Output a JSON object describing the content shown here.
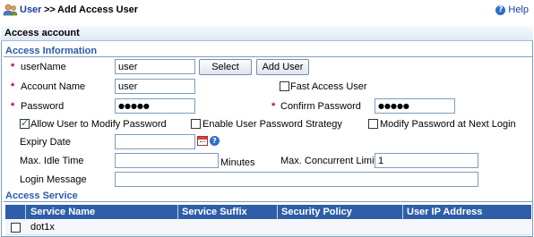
{
  "header": {
    "breadcrumb_link": "User",
    "breadcrumb_sep": ">>",
    "page_title": "Add Access User",
    "help_label": "Help",
    "help_icon": "?"
  },
  "panel": {
    "title": "Access account"
  },
  "access_info": {
    "section_title": "Access Information",
    "required_mark": "*",
    "username": {
      "label": "userName",
      "value": "user",
      "select_button": "Select",
      "add_button": "Add User"
    },
    "account_name": {
      "label": "Account Name",
      "value": "user"
    },
    "fast_access": {
      "label": "Fast Access User",
      "checked": false
    },
    "password": {
      "label": "Password",
      "value": "●●●●●"
    },
    "confirm_password": {
      "label": "Confirm Password",
      "value": "●●●●●"
    },
    "allow_modify_password": {
      "label": "Allow User to Modify Password",
      "checked": true
    },
    "enable_password_strategy": {
      "label": "Enable User Password Strategy",
      "checked": false
    },
    "modify_next_login": {
      "label": "Modify Password at Next Login",
      "checked": false
    },
    "expiry_date": {
      "label": "Expiry Date",
      "value": "",
      "calendar_icon": "calendar-icon",
      "help_icon": "?"
    },
    "max_idle_time": {
      "label": "Max. Idle Time",
      "value": "",
      "unit": "Minutes"
    },
    "max_concurrent_limit": {
      "label": "Max. Concurrent Limit",
      "value": "1"
    },
    "login_message": {
      "label": "Login Message",
      "value": ""
    }
  },
  "access_service": {
    "section_title": "Access Service",
    "columns": [
      "Service Name",
      "Service Suffix",
      "Security Policy",
      "User IP Address"
    ],
    "rows": [
      {
        "service_name": "dot1x",
        "service_suffix": "",
        "security_policy": "",
        "user_ip": "",
        "checked": false
      }
    ]
  },
  "colors": {
    "link": "#1a3fa0",
    "section": "#2b5aa8",
    "table_header": "#2e5ea8",
    "required": "#b1006f",
    "border": "#7f9db9"
  }
}
